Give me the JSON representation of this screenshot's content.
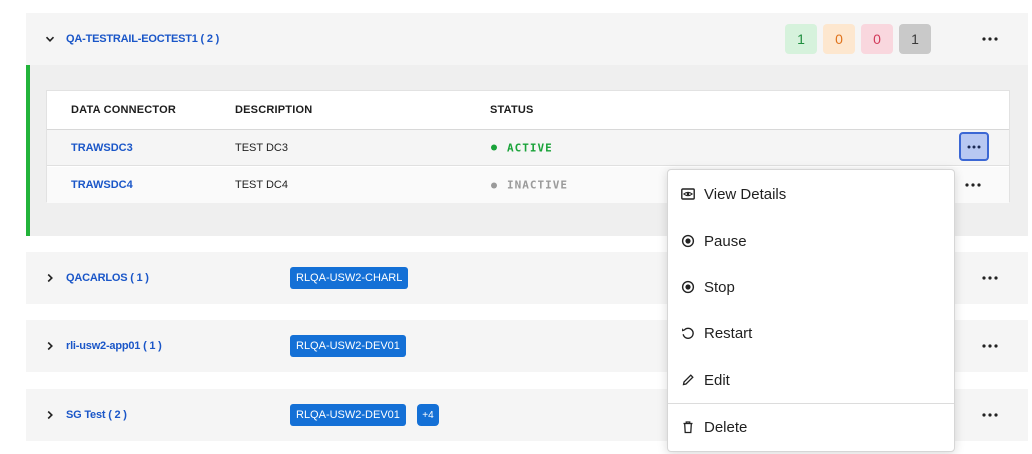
{
  "groups": [
    {
      "name": "QA-TESTRAIL-EOCTEST1 ( 2 )",
      "expanded": true,
      "counts": [
        "1",
        "0",
        "0",
        "1"
      ],
      "table": {
        "headers": {
          "connector": "DATA CONNECTOR",
          "description": "DESCRIPTION",
          "status": "STATUS"
        },
        "rows": [
          {
            "connector": "TRAWSDC3",
            "description": "TEST DC3",
            "status": "ACTIVE"
          },
          {
            "connector": "TRAWSDC4",
            "description": "TEST DC4",
            "status": "INACTIVE"
          }
        ]
      }
    },
    {
      "name": "QACARLOS ( 1 )",
      "expanded": false,
      "tag": "RLQA-USW2-CHARL"
    },
    {
      "name": "rli-usw2-app01 ( 1 )",
      "expanded": false,
      "tag": "RLQA-USW2-DEV01"
    },
    {
      "name": "SG Test ( 2 )",
      "expanded": false,
      "tag": "RLQA-USW2-DEV01",
      "more": "+4"
    }
  ],
  "context_menu": {
    "items": [
      {
        "label": "View Details",
        "icon": "eye-icon"
      },
      {
        "label": "Pause",
        "icon": "radio-dot-icon"
      },
      {
        "label": "Stop",
        "icon": "radio-dot-icon"
      },
      {
        "label": "Restart",
        "icon": "restart-icon"
      },
      {
        "label": "Edit",
        "icon": "pencil-icon"
      },
      {
        "label": "Delete",
        "icon": "trash-icon"
      }
    ]
  },
  "colors": {
    "link": "#1a56c8",
    "active": "#1aa33a",
    "inactive": "#9a9a9a",
    "accent_border": "#22b33a",
    "tag": "#1470d6"
  }
}
